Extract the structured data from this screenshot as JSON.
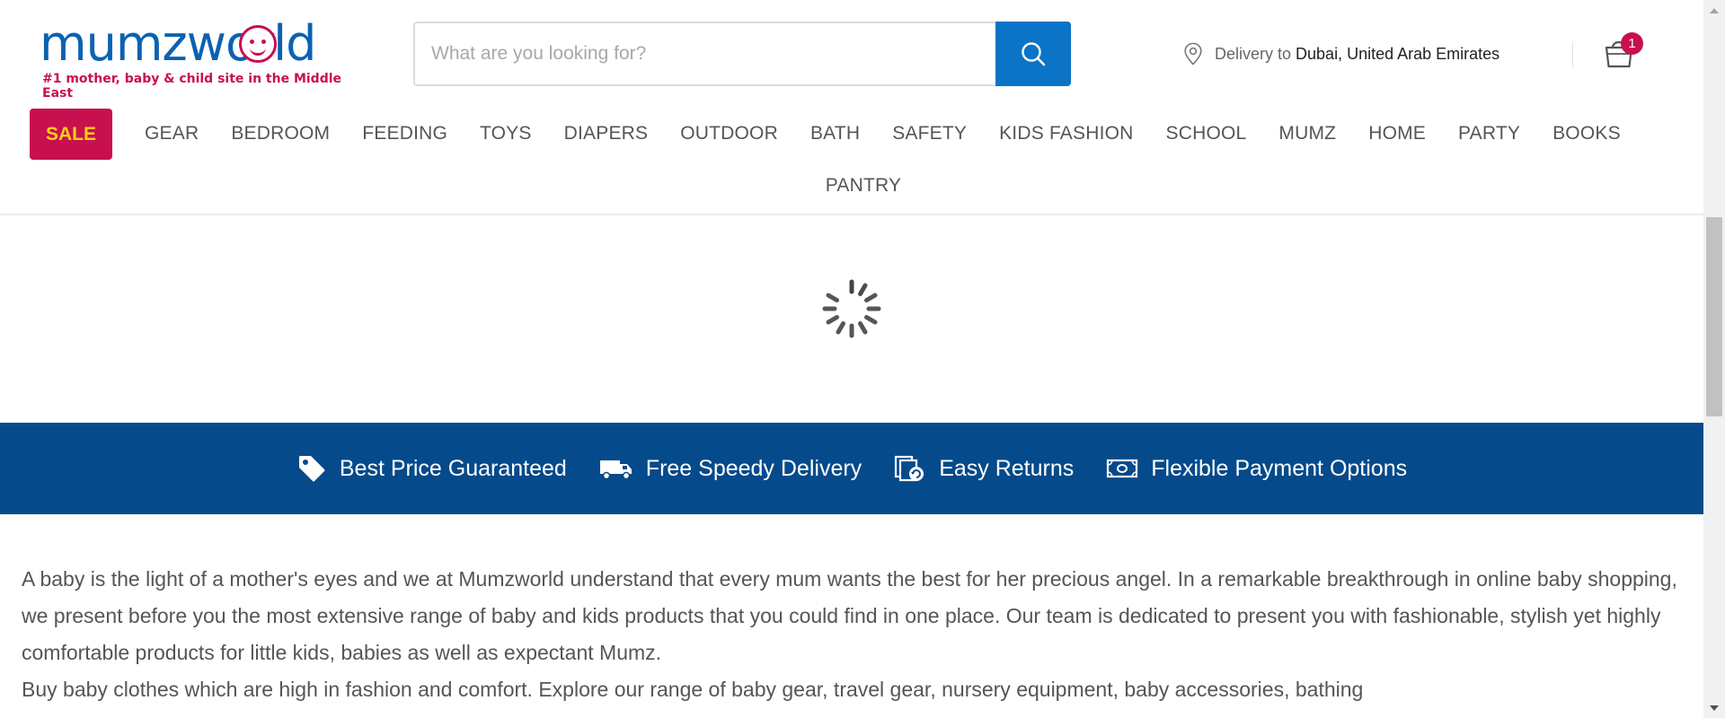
{
  "header": {
    "logo_text": "mumzworld",
    "tagline": "#1 mother, baby & child site in the Middle East",
    "search_placeholder": "What are you looking for?",
    "delivery_label": "Delivery to",
    "delivery_location": "Dubai, United Arab Emirates",
    "cart_count": "1"
  },
  "nav": {
    "sale": "SALE",
    "items": [
      "GEAR",
      "BEDROOM",
      "FEEDING",
      "TOYS",
      "DIAPERS",
      "OUTDOOR",
      "BATH",
      "SAFETY",
      "KIDS FASHION",
      "SCHOOL",
      "MUMZ",
      "HOME",
      "PARTY",
      "BOOKS",
      "PANTRY"
    ]
  },
  "trust": {
    "items": [
      {
        "label": "Best Price Guaranteed",
        "icon": "price-tag-icon"
      },
      {
        "label": "Free Speedy Delivery",
        "icon": "delivery-truck-icon"
      },
      {
        "label": "Easy Returns",
        "icon": "returns-icon"
      },
      {
        "label": "Flexible Payment Options",
        "icon": "payment-cash-icon"
      }
    ]
  },
  "description": {
    "p1": "A baby is the light of a mother's eyes and we at Mumzworld understand that every mum wants the best for her precious angel. In a remarkable breakthrough in online baby shopping, we present before you the most extensive range of baby and kids products that you could find in one place. Our team is dedicated to present you with fashionable, stylish yet highly comfortable products for little kids, babies as well as expectant Mumz.",
    "p2": "Buy baby clothes which are high in fashion and comfort. Explore our range of baby gear, travel gear, nursery equipment, baby accessories, bathing"
  },
  "colors": {
    "brand_blue": "#0b62b1",
    "brand_pink": "#c8104f",
    "sale_text": "#f9cf1a",
    "search_button": "#0b74c7",
    "trust_strip": "#054a8a"
  }
}
